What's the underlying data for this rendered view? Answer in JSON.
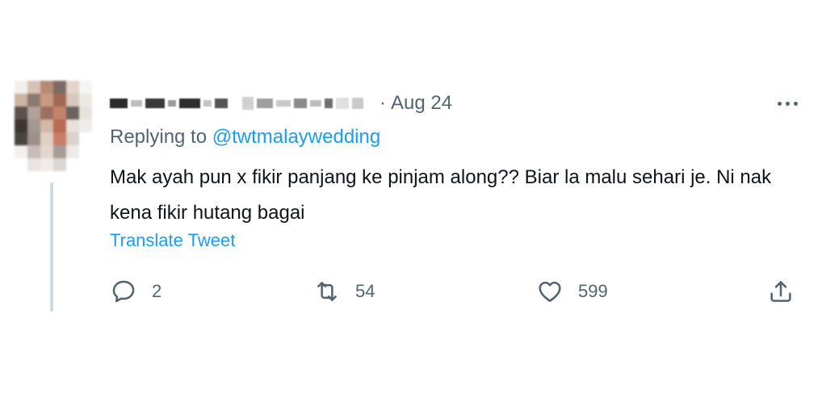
{
  "tweet": {
    "posted_date": "Aug 24",
    "dot_separator": "·",
    "replying_prefix": "Replying to",
    "replying_handle": "@twtmalaywedding",
    "text": "Mak ayah pun x fikir panjang ke pinjam along?? Biar la malu sehari je. Ni nak kena fikir hutang bagai",
    "translate_label": "Translate Tweet"
  },
  "actions": {
    "reply_count": "2",
    "retweet_count": "54",
    "like_count": "599"
  },
  "icons": {
    "reply": "reply-bubble-icon",
    "retweet": "retweet-icon",
    "like": "heart-icon",
    "share": "share-icon",
    "more": "more-options-icon"
  },
  "colors": {
    "accent": "#1d9bf0",
    "secondary_text": "#536471",
    "primary_text": "#0f1419",
    "thread_line": "#cfd9de"
  }
}
